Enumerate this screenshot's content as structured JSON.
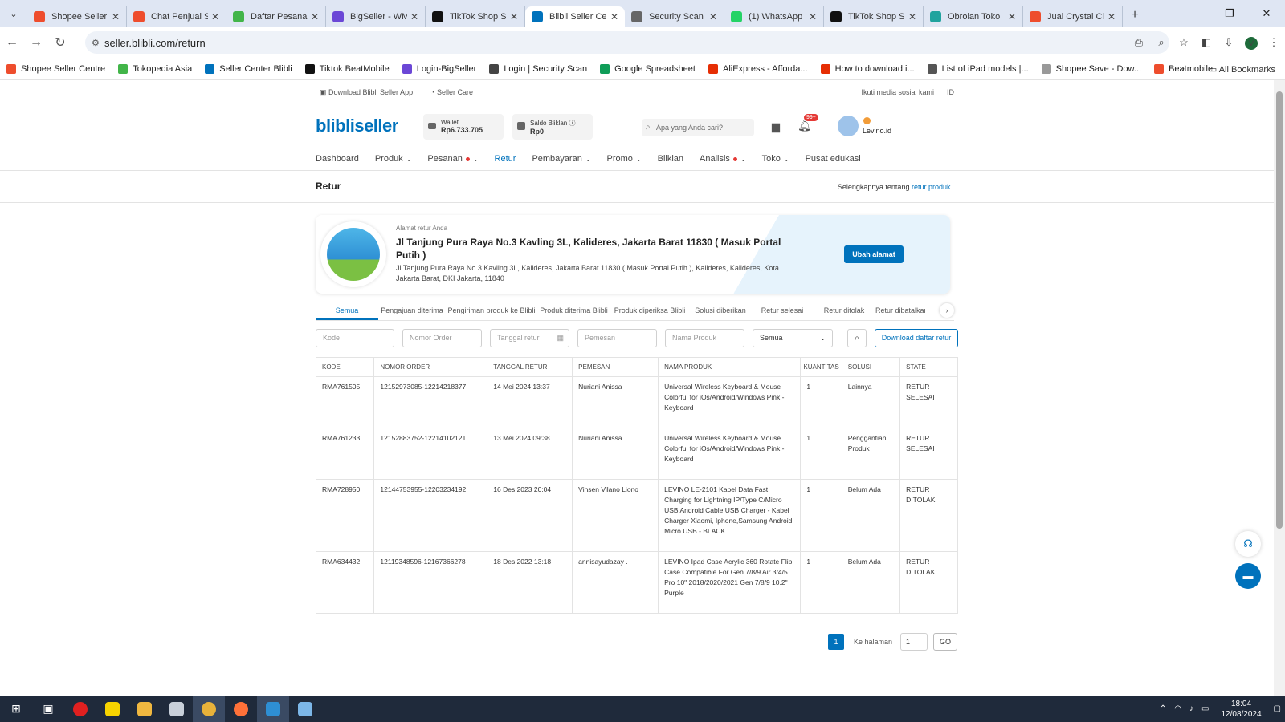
{
  "browser": {
    "tabs": [
      {
        "title": "Shopee Seller C",
        "color": "#ee4d2d"
      },
      {
        "title": "Chat Penjual Sh",
        "color": "#ee4d2d"
      },
      {
        "title": "Daftar Pesanan",
        "color": "#42b549"
      },
      {
        "title": "BigSeller - WM",
        "color": "#6b47d6"
      },
      {
        "title": "TikTok Shop Se",
        "color": "#111111"
      },
      {
        "title": "Blibli Seller Cen",
        "color": "#0072bc"
      },
      {
        "title": "Security Scan",
        "color": "#666666"
      },
      {
        "title": "(1) WhatsApp",
        "color": "#25d366"
      },
      {
        "title": "TikTok Shop Se",
        "color": "#111111"
      },
      {
        "title": "Obrolan Toko",
        "color": "#20a39e"
      },
      {
        "title": "Jual Crystal Cle",
        "color": "#ee4d2d"
      }
    ],
    "url": "seller.blibli.com/return",
    "bookmarks": [
      {
        "label": "Shopee Seller Centre",
        "color": "#ee4d2d"
      },
      {
        "label": "Tokopedia Asia",
        "color": "#42b549"
      },
      {
        "label": "Seller Center Blibli",
        "color": "#0072bc"
      },
      {
        "label": "Tiktok BeatMobile",
        "color": "#111111"
      },
      {
        "label": "Login-BigSeller",
        "color": "#6b47d6"
      },
      {
        "label": "Login | Security Scan",
        "color": "#444444"
      },
      {
        "label": "Google Spreadsheet",
        "color": "#0f9d58"
      },
      {
        "label": "AliExpress - Afforda...",
        "color": "#e62e04"
      },
      {
        "label": "How to download i...",
        "color": "#e62e04"
      },
      {
        "label": "List of iPad models |...",
        "color": "#555555"
      },
      {
        "label": "Shopee Save - Dow...",
        "color": "#999999"
      },
      {
        "label": "Beatmobile",
        "color": "#ee4d2d"
      }
    ],
    "all_bookmarks": "All Bookmarks"
  },
  "top": {
    "download_app": "Download Blibli Seller App",
    "seller_care": "Seller Care",
    "social": "Ikuti media sosial kami",
    "lang": "ID"
  },
  "header": {
    "logo_blibli": "blibli",
    "logo_seller": "seller",
    "wallet_label": "Wallet",
    "wallet_value": "Rp6.733.705",
    "saldo_label": "Saldo Bliklan",
    "saldo_value": "Rp0",
    "search_placeholder": "Apa yang Anda cari?",
    "notif_badge": "99+",
    "username": "Levino.id"
  },
  "menu": [
    {
      "label": "Dashboard",
      "chev": false,
      "dot": false,
      "active": false
    },
    {
      "label": "Produk",
      "chev": true,
      "dot": false,
      "active": false
    },
    {
      "label": "Pesanan",
      "chev": true,
      "dot": true,
      "active": false
    },
    {
      "label": "Retur",
      "chev": false,
      "dot": false,
      "active": true
    },
    {
      "label": "Pembayaran",
      "chev": true,
      "dot": false,
      "active": false
    },
    {
      "label": "Promo",
      "chev": true,
      "dot": false,
      "active": false
    },
    {
      "label": "Bliklan",
      "chev": false,
      "dot": false,
      "active": false
    },
    {
      "label": "Analisis",
      "chev": true,
      "dot": true,
      "active": false
    },
    {
      "label": "Toko",
      "chev": true,
      "dot": false,
      "active": false
    },
    {
      "label": "Pusat edukasi",
      "chev": false,
      "dot": false,
      "active": false
    }
  ],
  "page": {
    "title": "Retur",
    "info_prefix": "Selengkapnya tentang ",
    "info_link": "retur produk",
    "info_suffix": "."
  },
  "address": {
    "label": "Alamat retur Anda",
    "main": "Jl Tanjung Pura Raya No.3 Kavling 3L, Kalideres, Jakarta Barat 11830 ( Masuk Portal Putih )",
    "detail": "Jl Tanjung Pura Raya No.3 Kavling 3L, Kalideres, Jakarta Barat 11830 ( Masuk Portal Putih ), Kalideres, Kalideres, Kota Jakarta Barat, DKI Jakarta, 11840",
    "button": "Ubah alamat"
  },
  "status_tabs": [
    "Semua",
    "Pengajuan diterima",
    "Pengiriman produk ke Blibli",
    "Produk diterima Blibli",
    "Produk diperiksa Blibli",
    "Solusi diberikan",
    "Retur selesai",
    "Retur ditolak",
    "Retur dibatalkan"
  ],
  "filters": {
    "kode": "Kode",
    "nomor_order": "Nomor Order",
    "tanggal": "Tanggal retur",
    "pemesan": "Pemesan",
    "nama_produk": "Nama Produk",
    "select_value": "Semua",
    "download": "Download daftar retur"
  },
  "table": {
    "headers": [
      "KODE",
      "NOMOR ORDER",
      "TANGGAL RETUR",
      "PEMESAN",
      "NAMA PRODUK",
      "KUANTITAS",
      "SOLUSI",
      "STATE"
    ],
    "rows": [
      [
        "RMA761505",
        "12152973085-12214218377",
        "14 Mei 2024 13:37",
        "Nuriani Anissa",
        "Universal Wireless Keyboard & Mouse Colorful for iOs/Android/Windows Pink - Keyboard",
        "1",
        "Lainnya",
        "RETUR SELESAI"
      ],
      [
        "RMA761233",
        "12152883752-12214102121",
        "13 Mei 2024 09:38",
        "Nuriani Anissa",
        "Universal Wireless Keyboard & Mouse Colorful for iOs/Android/Windows Pink - Keyboard",
        "1",
        "Penggantian Produk",
        "RETUR SELESAI"
      ],
      [
        "RMA728950",
        "12144753955-12203234192",
        "16 Des 2023 20:04",
        "Vinsen Vilano Liono",
        "LEVINO LE-2101 Kabel Data Fast Charging for Lightning IP/Type C/Micro USB Android Cable USB Charger - Kabel Charger Xiaomi, Iphone,Samsung Android Micro USB - BLACK",
        "1",
        "Belum Ada",
        "RETUR DITOLAK"
      ],
      [
        "RMA634432",
        "12119348596-12167366278",
        "18 Des 2022 13:18",
        "annisayudazay .",
        "LEVINO Ipad Case Acrylic 360 Rotate Flip Case Compatible For Gen 7/8/9 Air 3/4/5 Pro 10\" 2018/2020/2021 Gen 7/8/9 10.2\" Purple",
        "1",
        "Belum Ada",
        "RETUR DITOLAK"
      ]
    ]
  },
  "pager": {
    "current": "1",
    "ke_halaman": "Ke halaman",
    "input": "1",
    "go": "GO"
  },
  "taskbar": {
    "time": "18:04",
    "date": "12/08/2024"
  }
}
